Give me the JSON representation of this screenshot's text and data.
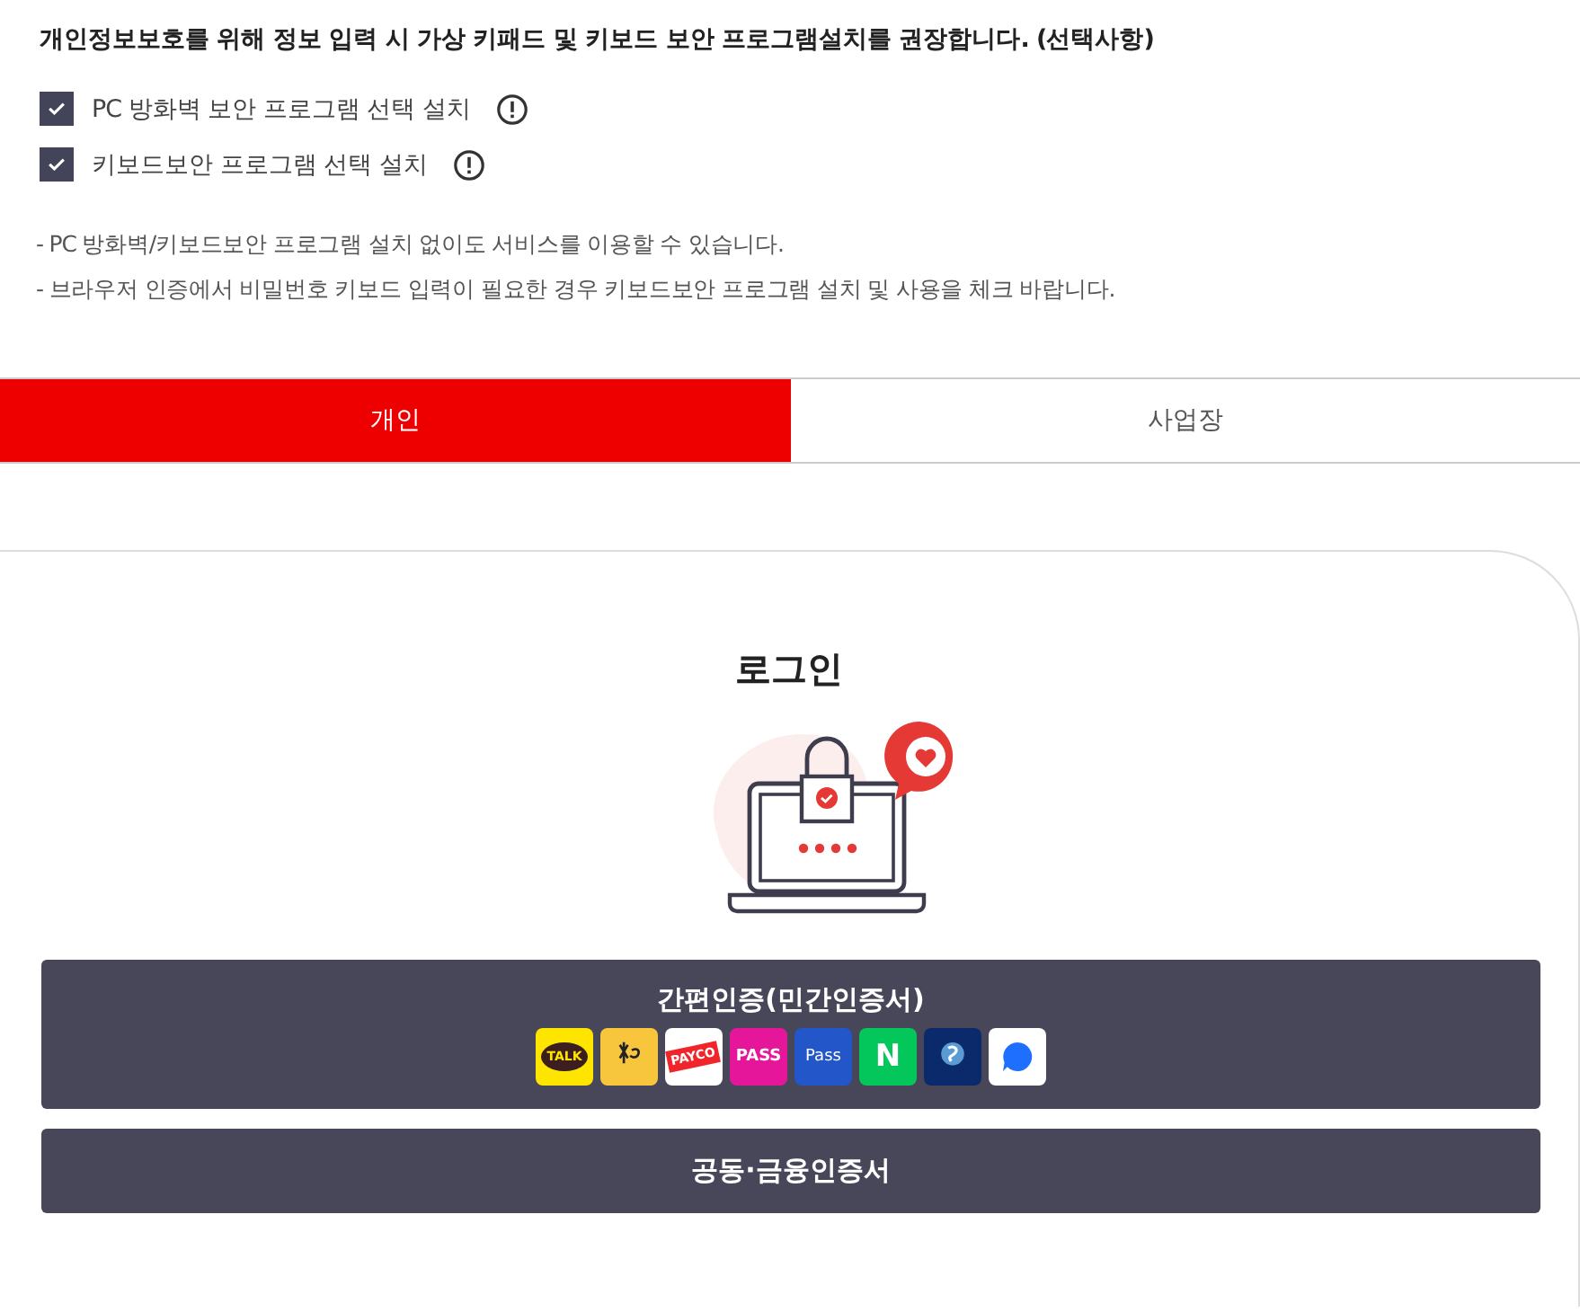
{
  "notice": "개인정보보호를 위해 정보 입력 시 가상 키패드 및 키보드 보안 프로그램설치를 권장합니다. (선택사항)",
  "options": [
    {
      "label": "PC 방화벽 보안 프로그램 선택 설치",
      "checked": true
    },
    {
      "label": "키보드보안 프로그램 선택 설치",
      "checked": true
    }
  ],
  "notes": [
    "- PC 방화벽/키보드보안 프로그램 설치 없이도 서비스를 이용할 수 있습니다.",
    "- 브라우저 인증에서 비밀번호 키보드 입력이 필요한 경우 키보드보안 프로그램 설치 및 사용을 체크 바랍니다."
  ],
  "tabs": [
    {
      "label": "개인",
      "selected": true
    },
    {
      "label": "사업장",
      "selected": false
    }
  ],
  "login": {
    "title": "로그인",
    "buttons": [
      {
        "label": "간편인증(민간인증서)",
        "providers": [
          {
            "kind": "talk",
            "label": "TALK"
          },
          {
            "kind": "kb"
          },
          {
            "kind": "payco",
            "label": "PAYCO"
          },
          {
            "kind": "pass",
            "label": "PASS"
          },
          {
            "kind": "samsung",
            "label": "Pass"
          },
          {
            "kind": "naver",
            "label": "N"
          },
          {
            "kind": "shinhan"
          },
          {
            "kind": "toss"
          }
        ]
      },
      {
        "label": "공동·금융인증서"
      }
    ]
  }
}
